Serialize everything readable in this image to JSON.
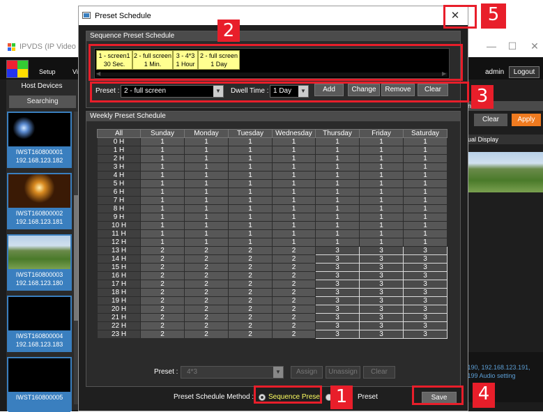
{
  "background_app": {
    "title": "IPVDS (IP Video Dist",
    "menu": [
      "Setup",
      "Vi"
    ],
    "user": "admin",
    "logout": "Logout",
    "host_devices": "Host Devices",
    "searching": "Searching",
    "devices": [
      {
        "name": "IWST160800001",
        "ip": "192.168.123.182"
      },
      {
        "name": "IWST160800002",
        "ip": "192.168.123.181"
      },
      {
        "name": "IWST160800003",
        "ip": "192.168.123.180"
      },
      {
        "name": "IWST160800004",
        "ip": "192.168.123.183"
      },
      {
        "name": "IWST160800005",
        "ip": ""
      }
    ],
    "ns_header": "ns",
    "clear": "Clear",
    "apply": "Apply",
    "visual_display": "ual Display",
    "info_line1": ".190, 192.168.123.191,",
    "info_line2": ".199 Audio setting",
    "win_min": "—",
    "win_max": "☐",
    "win_close": "✕"
  },
  "dialog": {
    "title": "Preset Schedule",
    "close": "✕",
    "sequence_section": {
      "header": "Sequence Preset Schedule",
      "items": [
        {
          "line1": "1  - screen1",
          "line2": "30 Sec."
        },
        {
          "line1": "2  - full screen",
          "line2": "1 Min."
        },
        {
          "line1": "3  - 4*3",
          "line2": "1 Hour"
        },
        {
          "line1": "2  - full screen",
          "line2": "1 Day"
        }
      ],
      "preset_label": "Preset :",
      "preset_value": "2  - full screen",
      "dwell_label": "Dwell Time :",
      "dwell_value": "1 Day",
      "add": "Add",
      "change": "Change",
      "remove": "Remove",
      "clear": "Clear"
    },
    "weekly_section": {
      "header": "Weekly Preset Schedule",
      "columns": [
        "All",
        "Sunday",
        "Monday",
        "Tuesday",
        "Wednesday",
        "Thursday",
        "Friday",
        "Saturday"
      ],
      "rows": [
        [
          "0 H",
          "1",
          "1",
          "1",
          "1",
          "1",
          "1",
          "1"
        ],
        [
          "1 H",
          "1",
          "1",
          "1",
          "1",
          "1",
          "1",
          "1"
        ],
        [
          "2 H",
          "1",
          "1",
          "1",
          "1",
          "1",
          "1",
          "1"
        ],
        [
          "3 H",
          "1",
          "1",
          "1",
          "1",
          "1",
          "1",
          "1"
        ],
        [
          "4 H",
          "1",
          "1",
          "1",
          "1",
          "1",
          "1",
          "1"
        ],
        [
          "5 H",
          "1",
          "1",
          "1",
          "1",
          "1",
          "1",
          "1"
        ],
        [
          "6 H",
          "1",
          "1",
          "1",
          "1",
          "1",
          "1",
          "1"
        ],
        [
          "7 H",
          "1",
          "1",
          "1",
          "1",
          "1",
          "1",
          "1"
        ],
        [
          "8 H",
          "1",
          "1",
          "1",
          "1",
          "1",
          "1",
          "1"
        ],
        [
          "9 H",
          "1",
          "1",
          "1",
          "1",
          "1",
          "1",
          "1"
        ],
        [
          "10 H",
          "1",
          "1",
          "1",
          "1",
          "1",
          "1",
          "1"
        ],
        [
          "11 H",
          "1",
          "1",
          "1",
          "1",
          "1",
          "1",
          "1"
        ],
        [
          "12 H",
          "1",
          "1",
          "1",
          "1",
          "1",
          "1",
          "1"
        ],
        [
          "13 H",
          "2",
          "2",
          "2",
          "2",
          "3",
          "3",
          "3"
        ],
        [
          "14 H",
          "2",
          "2",
          "2",
          "2",
          "3",
          "3",
          "3"
        ],
        [
          "15 H",
          "2",
          "2",
          "2",
          "2",
          "3",
          "3",
          "3"
        ],
        [
          "16 H",
          "2",
          "2",
          "2",
          "2",
          "3",
          "3",
          "3"
        ],
        [
          "17 H",
          "2",
          "2",
          "2",
          "2",
          "3",
          "3",
          "3"
        ],
        [
          "18 H",
          "2",
          "2",
          "2",
          "2",
          "3",
          "3",
          "3"
        ],
        [
          "19 H",
          "2",
          "2",
          "2",
          "2",
          "3",
          "3",
          "3"
        ],
        [
          "20 H",
          "2",
          "2",
          "2",
          "2",
          "3",
          "3",
          "3"
        ],
        [
          "21 H",
          "2",
          "2",
          "2",
          "2",
          "3",
          "3",
          "3"
        ],
        [
          "22 H",
          "2",
          "2",
          "2",
          "2",
          "3",
          "3",
          "3"
        ],
        [
          "23 H",
          "2",
          "2",
          "2",
          "2",
          "3",
          "3",
          "3"
        ]
      ],
      "preset_label": "Preset :",
      "preset_value": "4*3",
      "assign": "Assign",
      "unassign": "Unassign",
      "clear": "Clear"
    },
    "method_label": "Preset Schedule Method :",
    "method_sequence": "Sequence Preset",
    "method_preset": "Preset",
    "save": "Save"
  },
  "callouts": [
    "1",
    "2",
    "3",
    "4",
    "5"
  ],
  "colors": {
    "callout": "#e81e2a",
    "sequence_item": "#ffff90",
    "accent_blue": "#3a7fbf",
    "apply_orange": "#f07b20"
  }
}
